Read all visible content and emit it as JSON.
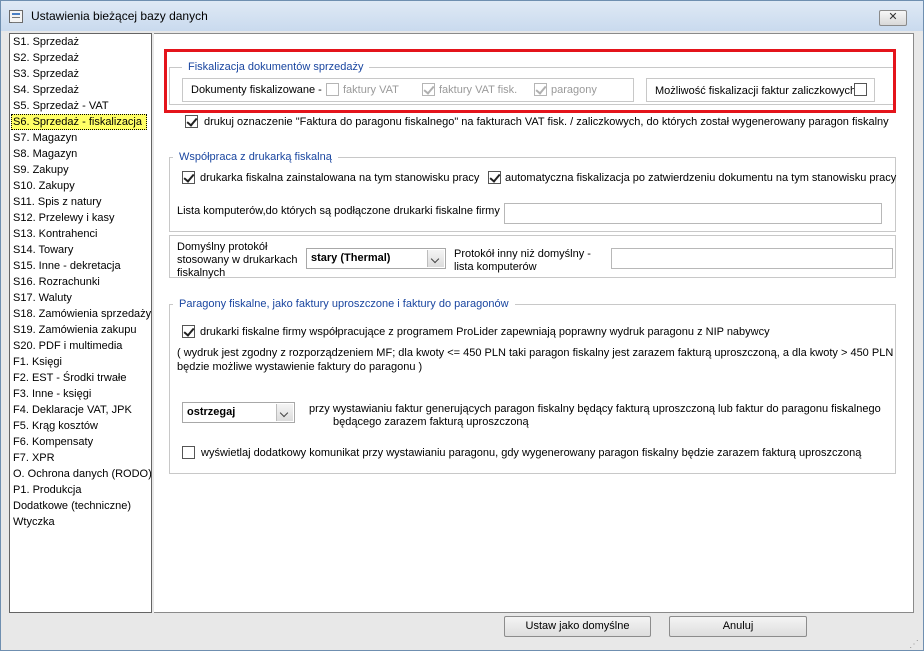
{
  "window": {
    "title": "Ustawienia bieżącej bazy danych",
    "close_label": "✕"
  },
  "sidebar": {
    "items": [
      {
        "label": "S1. Sprzedaż"
      },
      {
        "label": "S2. Sprzedaż"
      },
      {
        "label": "S3. Sprzedaż"
      },
      {
        "label": "S4. Sprzedaż"
      },
      {
        "label": "S5. Sprzedaż - VAT"
      },
      {
        "label": "S6. Sprzedaż - fiskalizacja",
        "selected": true
      },
      {
        "label": "S7. Magazyn"
      },
      {
        "label": "S8. Magazyn"
      },
      {
        "label": "S9. Zakupy"
      },
      {
        "label": "S10. Zakupy"
      },
      {
        "label": "S11. Spis z natury"
      },
      {
        "label": "S12. Przelewy i kasy"
      },
      {
        "label": "S13. Kontrahenci"
      },
      {
        "label": "S14. Towary"
      },
      {
        "label": "S15. Inne - dekretacja"
      },
      {
        "label": "S16. Rozrachunki"
      },
      {
        "label": "S17. Waluty"
      },
      {
        "label": "S18. Zamówienia sprzedaży"
      },
      {
        "label": "S19. Zamówienia zakupu"
      },
      {
        "label": "S20. PDF i multimedia"
      },
      {
        "label": "F1. Księgi"
      },
      {
        "label": "F2. EST - Środki trwałe"
      },
      {
        "label": "F3. Inne - księgi"
      },
      {
        "label": "F4. Deklaracje VAT, JPK"
      },
      {
        "label": "F5. Krąg kosztów"
      },
      {
        "label": "F6. Kompensaty"
      },
      {
        "label": "F7. XPR"
      },
      {
        "label": "O. Ochrona danych (RODO)"
      },
      {
        "label": "P1. Produkcja"
      },
      {
        "label": "Dodatkowe (techniczne)"
      },
      {
        "label": "Wtyczka"
      }
    ]
  },
  "fiskalizacja": {
    "legend": "Fiskalizacja dokumentów sprzedaży",
    "docs_label": "Dokumenty fiskalizowane -",
    "opt_faktury_vat": {
      "label": "faktury VAT",
      "checked": false
    },
    "opt_faktury_vat_fisk": {
      "label": "faktury VAT fisk.",
      "checked": true
    },
    "opt_paragony": {
      "label": "paragony",
      "checked": true
    },
    "zaliczkowe_label": "Możliwość fiskalizacji faktur zaliczkowych",
    "zaliczkowe_checked": false
  },
  "drukuj_oznaczenie": {
    "label": "drukuj oznaczenie \"Faktura do paragonu fiskalnego\" na fakturach VAT fisk. / zaliczkowych, do których został wygenerowany paragon fiskalny",
    "checked": true
  },
  "drukarka": {
    "legend": "Współpraca z drukarką fiskalną",
    "installed_label": "drukarka fiskalna zainstalowana na tym stanowisku pracy",
    "installed_checked": true,
    "auto_label": "automatyczna fiskalizacja po zatwierdzeniu dokumentu na tym stanowisku pracy",
    "auto_checked": true,
    "computers_label": "Lista komputerów,do których są podłączone drukarki fiskalne firmy",
    "computers_value": "",
    "protocol_label": "Domyślny protokół stosowany w drukarkach fiskalnych",
    "protocol_value": "stary (Thermal)",
    "protocol_other_label": "Protokół inny niż domyślny - lista komputerów",
    "protocol_other_value": ""
  },
  "paragony": {
    "legend": "Paragony fiskalne, jako faktury uproszczone i faktury do paragonów",
    "nip_label": "drukarki fiskalne firmy współpracujące z programem ProLider zapewniają poprawny wydruk paragonu z NIP nabywcy",
    "nip_checked": true,
    "note_line1": "( wydruk jest zgodny z rozporządzeniem MF; dla kwoty <= 450 PLN taki paragon fiskalny jest zarazem fakturą uproszczoną, a dla kwoty > 450 PLN",
    "note_line2": "będzie możliwe wystawienie faktury do paragonu )",
    "warn_value": "ostrzegaj",
    "warn_label_line1": "przy wystawianiu faktur generujących paragon fiskalny będący fakturą uproszczoną lub faktur do paragonu fiskalnego",
    "warn_label_line2": "będącego zarazem fakturą uproszczoną",
    "extra_msg_label": "wyświetlaj dodatkowy komunikat przy wystawianiu paragonu, gdy wygenerowany paragon fiskalny będzie zarazem fakturą uproszczoną",
    "extra_msg_checked": false
  },
  "buttons": {
    "default_label": "Ustaw jako domyślne",
    "cancel_label": "Anuluj"
  }
}
